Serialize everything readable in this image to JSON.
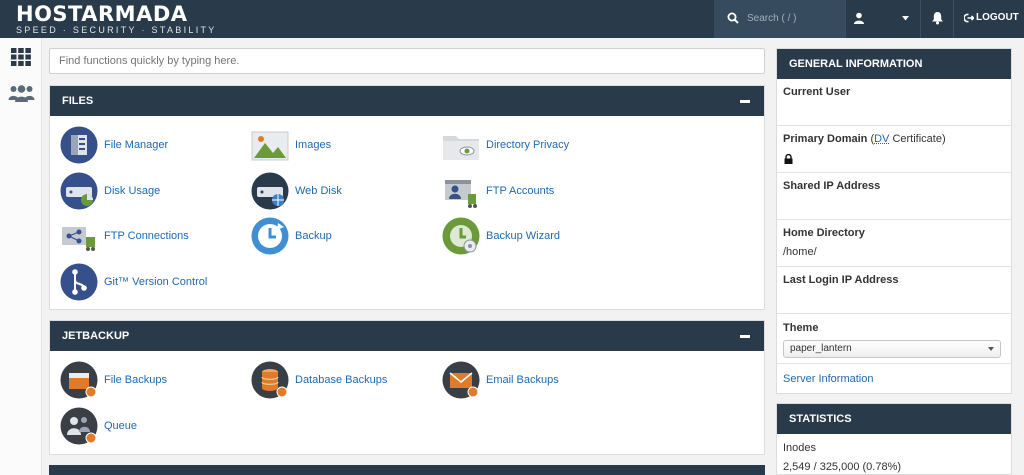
{
  "brand": {
    "name": "HOSTARMADA",
    "tagline": "SPEED · SECURITY · STABILITY"
  },
  "topbar": {
    "search_placeholder": "Search ( / )",
    "logout_label": "LOGOUT",
    "icons": [
      "search-icon",
      "user-icon",
      "caret-down-icon",
      "bell-icon",
      "logout-icon"
    ]
  },
  "rail": {
    "icons": [
      "apps-grid-icon",
      "users-icon"
    ]
  },
  "quickfind": {
    "placeholder": "Find functions quickly by typing here."
  },
  "files": {
    "title": "FILES",
    "items": [
      {
        "label": "File Manager",
        "icon": "file-manager-icon"
      },
      {
        "label": "Images",
        "icon": "images-icon"
      },
      {
        "label": "Directory Privacy",
        "icon": "directory-privacy-icon"
      },
      {
        "label": "Disk Usage",
        "icon": "disk-usage-icon"
      },
      {
        "label": "Web Disk",
        "icon": "web-disk-icon"
      },
      {
        "label": "FTP Accounts",
        "icon": "ftp-accounts-icon"
      },
      {
        "label": "FTP Connections",
        "icon": "ftp-connections-icon"
      },
      {
        "label": "Backup",
        "icon": "backup-icon"
      },
      {
        "label": "Backup Wizard",
        "icon": "backup-wizard-icon"
      },
      {
        "label": "Git™ Version Control",
        "icon": "git-icon"
      }
    ]
  },
  "jetbackup": {
    "title": "JETBACKUP",
    "items": [
      {
        "label": "File Backups",
        "icon": "file-backups-icon"
      },
      {
        "label": "Database Backups",
        "icon": "database-backups-icon"
      },
      {
        "label": "Email Backups",
        "icon": "email-backups-icon"
      },
      {
        "label": "Queue",
        "icon": "queue-icon"
      }
    ]
  },
  "general_info": {
    "title": "GENERAL INFORMATION",
    "current_user_label": "Current User",
    "primary_domain_label": "Primary Domain",
    "dv_open": "(",
    "dv_abbr": "DV",
    "dv_rest": " Certificate)",
    "shared_ip_label": "Shared IP Address",
    "home_dir_label": "Home Directory",
    "home_dir_value": "/home/",
    "last_login_label": "Last Login IP Address",
    "theme_label": "Theme",
    "theme_value": "paper_lantern",
    "server_info_link": "Server Information"
  },
  "statistics": {
    "title": "STATISTICS",
    "inodes_label": "Inodes",
    "inodes_value": "2,549 / 325,000   (0.78%)"
  },
  "colors": {
    "header_bg": "#293a4a",
    "link": "#1f69b0",
    "icon_navy": "#35508a",
    "icon_green": "#6a9a3a",
    "icon_orange": "#e07b2a"
  }
}
